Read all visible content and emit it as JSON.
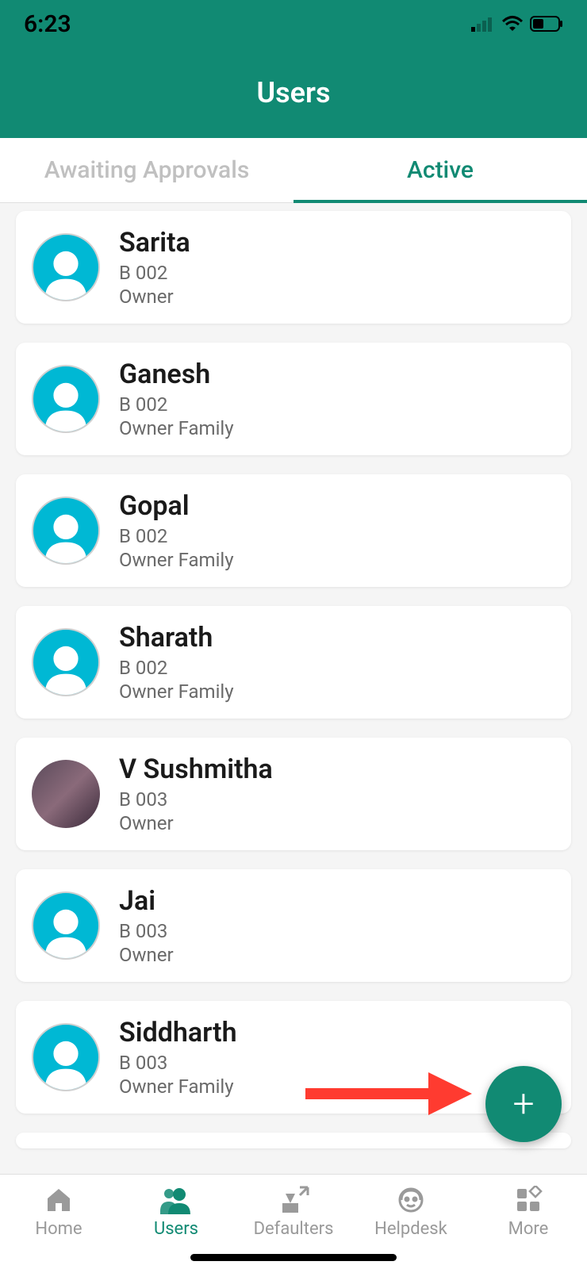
{
  "status": {
    "time": "6:23"
  },
  "header": {
    "title": "Users"
  },
  "tabs": [
    {
      "label": "Awaiting Approvals",
      "active": false
    },
    {
      "label": "Active",
      "active": true
    }
  ],
  "users": [
    {
      "name": "Sarita",
      "unit": "B 002",
      "role": "Owner",
      "has_photo": false
    },
    {
      "name": "Ganesh",
      "unit": "B 002",
      "role": "Owner Family",
      "has_photo": false
    },
    {
      "name": "Gopal",
      "unit": "B 002",
      "role": "Owner Family",
      "has_photo": false
    },
    {
      "name": "Sharath",
      "unit": "B 002",
      "role": "Owner Family",
      "has_photo": false
    },
    {
      "name": "V Sushmitha",
      "unit": "B 003",
      "role": "Owner",
      "has_photo": true
    },
    {
      "name": "Jai",
      "unit": "B 003",
      "role": "Owner",
      "has_photo": false
    },
    {
      "name": "Siddharth",
      "unit": "B 003",
      "role": "Owner Family",
      "has_photo": false
    }
  ],
  "bottom_nav": [
    {
      "label": "Home",
      "icon": "home",
      "active": false
    },
    {
      "label": "Users",
      "icon": "users",
      "active": true
    },
    {
      "label": "Defaulters",
      "icon": "defaulters",
      "active": false
    },
    {
      "label": "Helpdesk",
      "icon": "headset",
      "active": false
    },
    {
      "label": "More",
      "icon": "grid",
      "active": false
    }
  ],
  "colors": {
    "primary": "#118a73",
    "accent_red": "#ff3b30"
  }
}
